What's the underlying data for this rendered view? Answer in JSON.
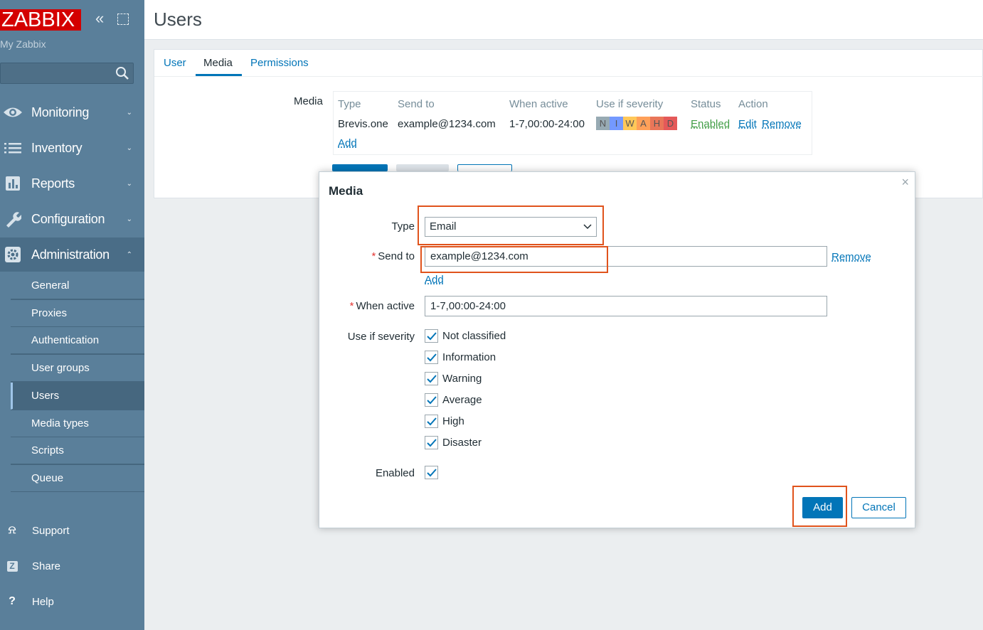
{
  "sidebar": {
    "logo": "ZABBIX",
    "subtitle": "My Zabbix",
    "search_placeholder": "",
    "menu": [
      {
        "label": "Monitoring",
        "icon": "eye-icon"
      },
      {
        "label": "Inventory",
        "icon": "list-icon"
      },
      {
        "label": "Reports",
        "icon": "bar-chart-icon"
      },
      {
        "label": "Configuration",
        "icon": "wrench-icon"
      },
      {
        "label": "Administration",
        "icon": "gear-icon"
      }
    ],
    "admin_submenu": [
      "General",
      "Proxies",
      "Authentication",
      "User groups",
      "Users",
      "Media types",
      "Scripts",
      "Queue"
    ],
    "bottom": [
      {
        "label": "Support",
        "icon": "headset-icon"
      },
      {
        "label": "Share",
        "icon": "share-z-icon"
      },
      {
        "label": "Help",
        "icon": "question-icon"
      }
    ]
  },
  "header": {
    "title": "Users"
  },
  "tabs": [
    "User",
    "Media",
    "Permissions"
  ],
  "media_section": {
    "label": "Media",
    "columns": [
      "Type",
      "Send to",
      "When active",
      "Use if severity",
      "Status",
      "Action"
    ],
    "row": {
      "type": "Brevis.one",
      "send_to": "example@1234.com",
      "when_active": "1-7,00:00-24:00",
      "severity": [
        "N",
        "I",
        "W",
        "A",
        "H",
        "D"
      ],
      "status": "Enabled",
      "edit": "Edit",
      "remove": "Remove"
    },
    "add": "Add"
  },
  "modal": {
    "title": "Media",
    "close": "×",
    "type_label": "Type",
    "type_value": "Email",
    "send_to_label": "Send to",
    "send_to_value": "example@1234.com",
    "remove": "Remove",
    "add_link": "Add",
    "when_active_label": "When active",
    "when_active_value": "1-7,00:00-24:00",
    "severity_label": "Use if severity",
    "severities": [
      "Not classified",
      "Information",
      "Warning",
      "Average",
      "High",
      "Disaster"
    ],
    "enabled_label": "Enabled",
    "add_button": "Add",
    "cancel_button": "Cancel"
  },
  "colors": {
    "sidebar": "#5a7f9a",
    "accent": "#0275b8",
    "highlight": "#e0531c",
    "sev_not_classified": "#97aab3",
    "sev_information": "#7499ff",
    "sev_warning": "#ffc859",
    "sev_average": "#ffa059",
    "sev_high": "#e97659",
    "sev_disaster": "#e45959"
  }
}
